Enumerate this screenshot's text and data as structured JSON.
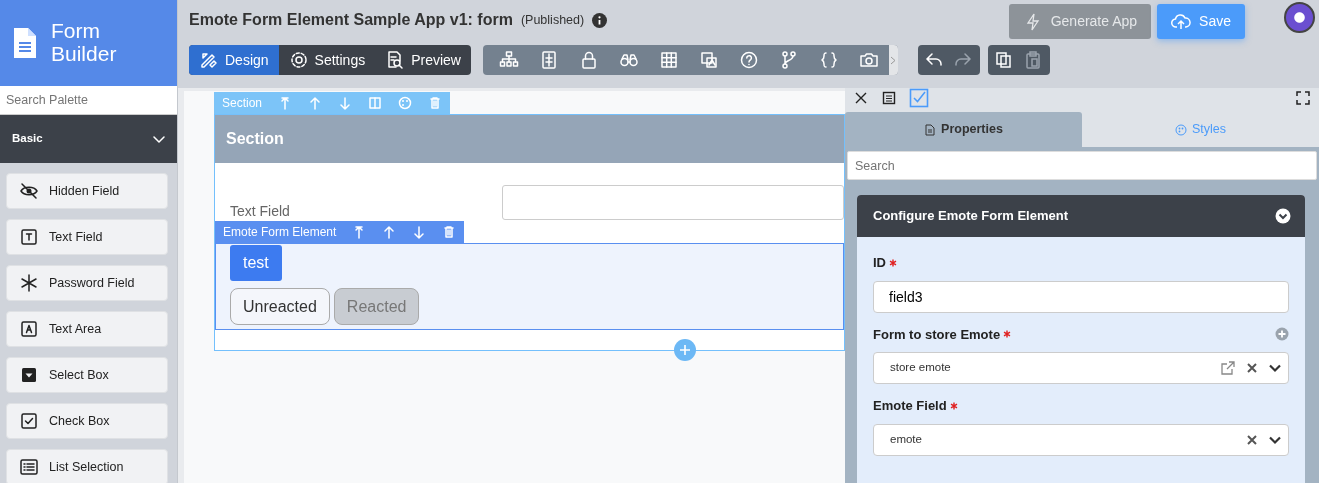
{
  "sidebar": {
    "brand": {
      "line_1": "Form",
      "line_2": "Builder"
    },
    "search": {
      "placeholder": "Search Palette"
    },
    "category": {
      "label": "Basic",
      "expanded": true
    },
    "items": [
      {
        "label": "Hidden Field",
        "kind": "hidden"
      },
      {
        "label": "Text Field",
        "kind": "text"
      },
      {
        "label": "Password Field",
        "kind": "password"
      },
      {
        "label": "Text Area",
        "kind": "textarea"
      },
      {
        "label": "Select Box",
        "kind": "select"
      },
      {
        "label": "Check Box",
        "kind": "checkbox"
      },
      {
        "label": "List Selection",
        "kind": "list"
      }
    ]
  },
  "header": {
    "title": "Emote Form Element Sample App v1: form",
    "status": "(Published)",
    "mode_tabs": [
      {
        "label": "Design",
        "kind": "design",
        "selected": true
      },
      {
        "label": "Settings",
        "kind": "settings",
        "selected": false
      },
      {
        "label": "Preview",
        "kind": "preview",
        "selected": false
      }
    ],
    "history_buttons": [
      {
        "kind": "undo",
        "disabled": false
      },
      {
        "kind": "redo",
        "disabled": true
      }
    ],
    "clipboard_buttons": [
      {
        "kind": "copy",
        "disabled": false
      },
      {
        "kind": "paste",
        "disabled": true
      }
    ],
    "actions": [
      {
        "label": "Generate App",
        "kind": "generate",
        "disabled": true
      },
      {
        "label": "Save",
        "kind": "save",
        "disabled": false
      }
    ]
  },
  "canvas": {
    "section_toolbar": {
      "label": "Section"
    },
    "section": {
      "title": "Section",
      "field_label": "Text Field"
    },
    "element_toolbar": {
      "label": "Emote Form Element"
    },
    "emote_button": "test",
    "reactions": [
      {
        "label": "Unreacted",
        "selected": false
      },
      {
        "label": "Reacted",
        "selected": true
      }
    ]
  },
  "panel": {
    "tabs": [
      {
        "label": "Properties",
        "kind": "properties",
        "selected": true
      },
      {
        "label": "Styles",
        "kind": "styles",
        "selected": false
      }
    ],
    "search": {
      "placeholder": "Search"
    },
    "config_title": "Configure Emote Form Element",
    "fields": [
      {
        "label": "ID",
        "required": true,
        "kind": "text",
        "value": "field3"
      },
      {
        "label": "Form to store Emote",
        "required": true,
        "kind": "select",
        "value": "store emote",
        "edit_link": true,
        "add_button": true
      },
      {
        "label": "Emote Field",
        "required": true,
        "kind": "select",
        "value": "emote"
      }
    ]
  }
}
